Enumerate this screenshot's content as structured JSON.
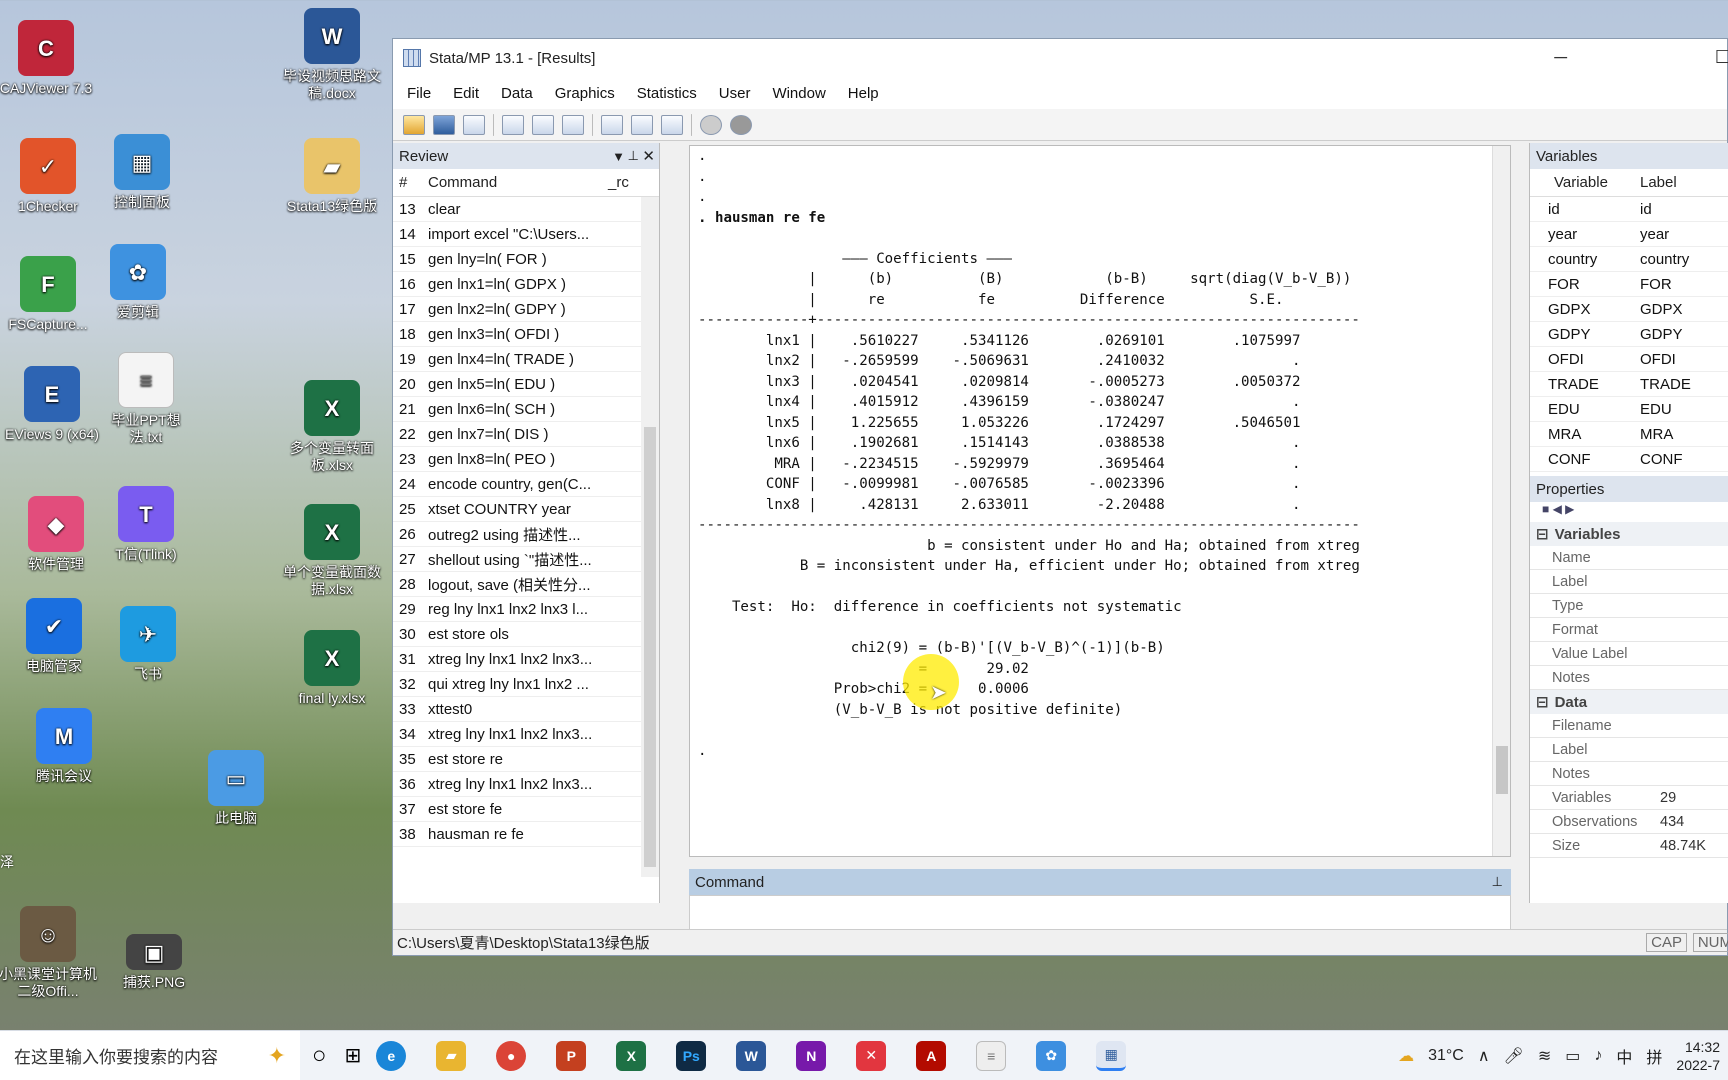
{
  "desktop": {
    "icons": [
      {
        "label": "CAJViewer 7.3",
        "icon": "cajviewer-icon",
        "color": "#c0263a"
      },
      {
        "label": "1Checker",
        "icon": "1checker-icon",
        "color": "#e2542a"
      },
      {
        "label": "FSCapture...",
        "icon": "fscapture-icon",
        "color": "#3aa14a"
      },
      {
        "label": "EViews 9 (x64)",
        "icon": "eviews-icon",
        "color": "#2d64b3"
      },
      {
        "label": "软件管理",
        "icon": "software-manager-icon",
        "color": "#e24d7c"
      },
      {
        "label": "电脑管家",
        "icon": "pc-manager-icon",
        "color": "#1a6fe0"
      },
      {
        "label": "腾讯会议",
        "icon": "tencent-meeting-icon",
        "color": "#2f7ff2"
      },
      {
        "label": "小黑课堂计算机二级Offi...",
        "icon": "xiaohei-icon",
        "color": "#6b5a43"
      },
      {
        "label": "控制面板",
        "icon": "control-panel-icon",
        "color": "#3b8fd6"
      },
      {
        "label": "爱剪辑",
        "icon": "ijianji-icon",
        "color": "#3e92e0"
      },
      {
        "label": "毕业PPT想法.txt",
        "icon": "txt-file-icon",
        "color": "#f4f4f4"
      },
      {
        "label": "T信(Tlink)",
        "icon": "tlink-icon",
        "color": "#7a5cf0"
      },
      {
        "label": "飞书",
        "icon": "feishu-icon",
        "color": "#1e9be0"
      },
      {
        "label": "此电脑",
        "icon": "this-pc-icon",
        "color": "#4b9be4"
      },
      {
        "label": "捕获.PNG",
        "icon": "png-file-icon",
        "color": "#444"
      },
      {
        "label": "毕设视频思路文稿.docx",
        "icon": "word-doc-icon",
        "color": "#2b5797"
      },
      {
        "label": "Stata13绿色版",
        "icon": "folder-icon",
        "color": "#e9c46a"
      },
      {
        "label": "多个变量转面板.xlsx",
        "icon": "excel-file-icon",
        "color": "#1e7145"
      },
      {
        "label": "单个变量截面数据.xlsx",
        "icon": "excel-file-icon",
        "color": "#1e7145"
      },
      {
        "label": "final ly.xlsx",
        "icon": "excel-file-icon",
        "color": "#1e7145"
      }
    ],
    "edge_text": "泽"
  },
  "window": {
    "title": "Stata/MP 13.1 - [Results]",
    "min_glyph": "─",
    "max_glyph": "☐",
    "menu": [
      "File",
      "Edit",
      "Data",
      "Graphics",
      "Statistics",
      "User",
      "Window",
      "Help"
    ]
  },
  "review": {
    "title": "Review",
    "cols": [
      "#",
      "Command",
      "_rc"
    ],
    "rows": [
      {
        "n": "13",
        "c": "clear"
      },
      {
        "n": "14",
        "c": "import excel \"C:\\Users..."
      },
      {
        "n": "15",
        "c": "gen lny=ln( FOR )"
      },
      {
        "n": "16",
        "c": "gen lnx1=ln( GDPX )"
      },
      {
        "n": "17",
        "c": "gen lnx2=ln( GDPY )"
      },
      {
        "n": "18",
        "c": "gen lnx3=ln( OFDI )"
      },
      {
        "n": "19",
        "c": "gen lnx4=ln( TRADE )"
      },
      {
        "n": "20",
        "c": "gen lnx5=ln( EDU )"
      },
      {
        "n": "21",
        "c": "gen lnx6=ln( SCH )"
      },
      {
        "n": "22",
        "c": "gen lnx7=ln( DIS )"
      },
      {
        "n": "23",
        "c": "gen lnx8=ln( PEO )"
      },
      {
        "n": "24",
        "c": "encode country, gen(C..."
      },
      {
        "n": "25",
        "c": "xtset COUNTRY year"
      },
      {
        "n": "26",
        "c": "outreg2 using 描述性..."
      },
      {
        "n": "27",
        "c": "shellout using `\"描述性..."
      },
      {
        "n": "28",
        "c": "logout, save (相关性分..."
      },
      {
        "n": "29",
        "c": "reg lny lnx1 lnx2 lnx3 l..."
      },
      {
        "n": "30",
        "c": "est store ols"
      },
      {
        "n": "31",
        "c": "xtreg lny lnx1 lnx2 lnx3..."
      },
      {
        "n": "32",
        "c": "qui xtreg lny lnx1 lnx2 ..."
      },
      {
        "n": "33",
        "c": "xttest0"
      },
      {
        "n": "34",
        "c": "xtreg lny lnx1 lnx2 lnx3..."
      },
      {
        "n": "35",
        "c": "est store re"
      },
      {
        "n": "36",
        "c": "xtreg lny lnx1 lnx2 lnx3..."
      },
      {
        "n": "37",
        "c": "est store fe"
      },
      {
        "n": "38",
        "c": "hausman re fe"
      }
    ]
  },
  "results": {
    "lines": [
      ".",
      ".",
      ".",
      ". hausman re fe",
      "",
      "                 ——— Coefficients ———",
      "             |      (b)          (B)            (b-B)     sqrt(diag(V_b-V_B))",
      "             |      re           fe          Difference          S.E.",
      "-------------+----------------------------------------------------------------",
      "        lnx1 |    .5610227     .5341126        .0269101        .1075997",
      "        lnx2 |   -.2659599    -.5069631        .2410032               .",
      "        lnx3 |    .0204541     .0209814       -.0005273        .0050372",
      "        lnx4 |    .4015912     .4396159       -.0380247               .",
      "        lnx5 |    1.225655     1.053226        .1724297        .5046501",
      "        lnx6 |    .1902681     .1514143        .0388538               .",
      "         MRA |   -.2234515    -.5929979        .3695464               .",
      "        CONF |   -.0099981    -.0076585       -.0023396               .",
      "        lnx8 |     .428131     2.633011        -2.20488               .",
      "------------------------------------------------------------------------------",
      "                           b = consistent under Ho and Ha; obtained from xtreg",
      "            B = inconsistent under Ha, efficient under Ho; obtained from xtreg",
      "",
      "    Test:  Ho:  difference in coefficients not systematic",
      "",
      "                  chi2(9) = (b-B)'[(V_b-V_B)^(-1)](b-B)",
      "                          =       29.02",
      "                Prob>chi2 =      0.0006",
      "                (V_b-V_B is not positive definite)",
      "",
      "."
    ]
  },
  "command": {
    "title": "Command",
    "value": ""
  },
  "variables": {
    "title": "Variables",
    "cols": [
      "Variable",
      "Label"
    ],
    "rows": [
      [
        "id",
        "id"
      ],
      [
        "year",
        "year"
      ],
      [
        "country",
        "country"
      ],
      [
        "FOR",
        "FOR"
      ],
      [
        "GDPX",
        "GDPX"
      ],
      [
        "GDPY",
        "GDPY"
      ],
      [
        "OFDI",
        "OFDI"
      ],
      [
        "TRADE",
        "TRADE"
      ],
      [
        "EDU",
        "EDU"
      ],
      [
        "MRA",
        "MRA"
      ],
      [
        "CONF",
        "CONF"
      ]
    ]
  },
  "properties": {
    "title": "Properties",
    "variables_section": "Variables",
    "variables_props": [
      [
        "Name",
        ""
      ],
      [
        "Label",
        ""
      ],
      [
        "Type",
        ""
      ],
      [
        "Format",
        ""
      ],
      [
        "Value Label",
        ""
      ],
      [
        "Notes",
        ""
      ]
    ],
    "data_section": "Data",
    "data_props": [
      [
        "Filename",
        ""
      ],
      [
        "Label",
        ""
      ],
      [
        "Notes",
        ""
      ],
      [
        "Variables",
        "29"
      ],
      [
        "Observations",
        "434"
      ],
      [
        "Size",
        "48.74K"
      ]
    ]
  },
  "statusbar": {
    "path": "C:\\Users\\夏青\\Desktop\\Stata13绿色版",
    "cap": "CAP",
    "num": "NUM"
  },
  "taskbar": {
    "search_placeholder": "在这里输入你要搜索的内容",
    "weather": "31°C",
    "ime": "中",
    "ime2": "拼",
    "time": "14:32",
    "date": "2022-7"
  }
}
